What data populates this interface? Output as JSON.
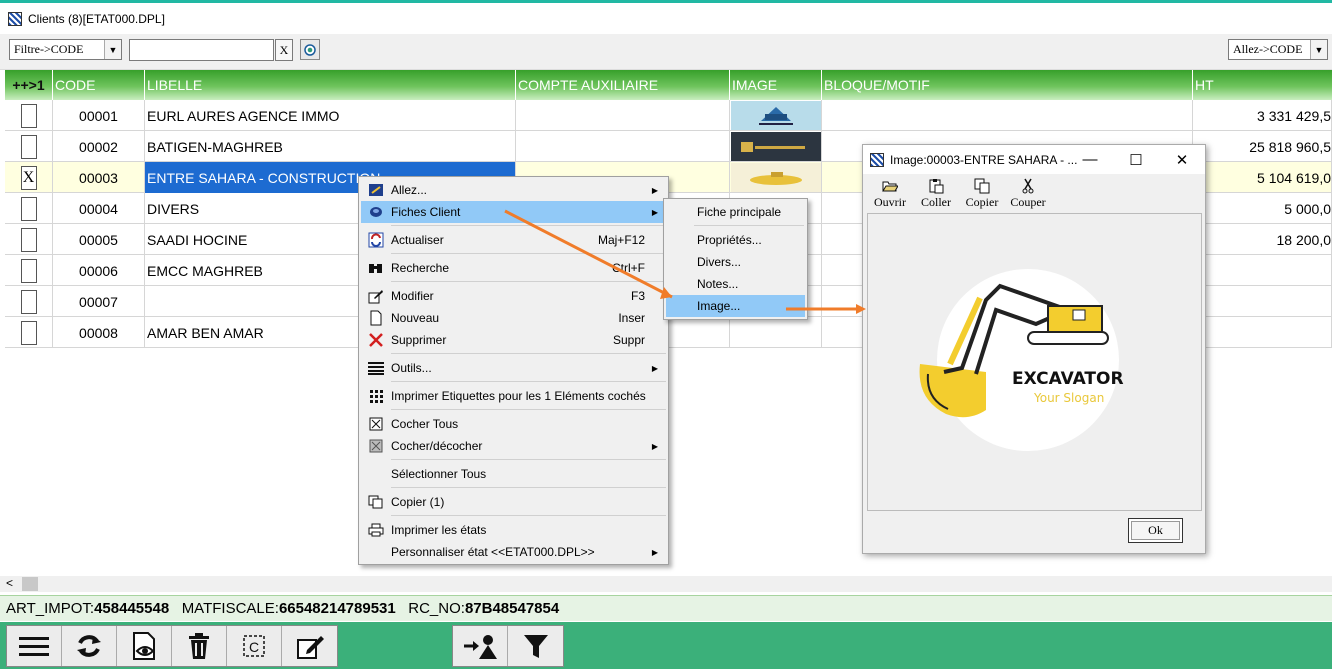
{
  "window": {
    "title": "Clients (8)[ETAT000.DPL]"
  },
  "toolbar": {
    "filter_select": "Filtre->CODE",
    "search_value": "",
    "clear_label": "X",
    "goto_select": "Allez->CODE"
  },
  "grid": {
    "columns": [
      "++>1",
      "CODE",
      "LIBELLE",
      "COMPTE AUXILIAIRE",
      "IMAGE",
      "BLOQUE/MOTIF",
      "HT"
    ],
    "rows": [
      {
        "checked": "",
        "code": "00001",
        "libelle": "EURL AURES AGENCE IMMO",
        "compte": "",
        "bloque": "",
        "ht": "3 331 429,5"
      },
      {
        "checked": "",
        "code": "00002",
        "libelle": "BATIGEN-MAGHREB",
        "compte": "",
        "bloque": "",
        "ht": "25 818 960,5"
      },
      {
        "checked": "X",
        "code": "00003",
        "libelle": "ENTRE SAHARA - CONSTRUCTION",
        "compte": "",
        "bloque": "",
        "ht": "5 104 619,0"
      },
      {
        "checked": "",
        "code": "00004",
        "libelle": "DIVERS",
        "compte": "",
        "bloque": "",
        "ht": "5 000,0"
      },
      {
        "checked": "",
        "code": "00005",
        "libelle": "SAADI HOCINE",
        "compte": "",
        "bloque": "",
        "ht": "18 200,0"
      },
      {
        "checked": "",
        "code": "00006",
        "libelle": "EMCC MAGHREB",
        "compte": "",
        "bloque": "",
        "ht": ""
      },
      {
        "checked": "",
        "code": "00007",
        "libelle": "",
        "compte": "",
        "bloque": "",
        "ht": ""
      },
      {
        "checked": "",
        "code": "00008",
        "libelle": "AMAR BEN AMAR",
        "compte": "",
        "bloque": "",
        "ht": ""
      }
    ]
  },
  "context_menu": {
    "items": [
      {
        "label": "Allez...",
        "shortcut": "",
        "icon": "goto-icon"
      },
      {
        "label": "Fiches Client",
        "shortcut": "",
        "icon": "client-card-icon"
      },
      {
        "label": "Actualiser",
        "shortcut": "Maj+F12",
        "icon": "refresh-icon"
      },
      {
        "label": "Recherche",
        "shortcut": "Ctrl+F",
        "icon": "binoculars-icon"
      },
      {
        "label": "Modifier",
        "shortcut": "F3",
        "icon": "edit-icon"
      },
      {
        "label": "Nouveau",
        "shortcut": "Inser",
        "icon": "new-document-icon"
      },
      {
        "label": "Supprimer",
        "shortcut": "Suppr",
        "icon": "delete-x-icon"
      },
      {
        "label": "Outils...",
        "shortcut": "",
        "icon": "tools-icon"
      },
      {
        "label": "Imprimer Etiquettes pour les 1 Eléments cochés",
        "shortcut": "",
        "icon": "labels-grid-icon"
      },
      {
        "label": "Cocher Tous",
        "shortcut": "",
        "icon": "check-all-icon"
      },
      {
        "label": "Cocher/décocher",
        "shortcut": "",
        "icon": "toggle-check-icon"
      },
      {
        "label": "Sélectionner Tous",
        "shortcut": "",
        "icon": ""
      },
      {
        "label": "Copier (1)",
        "shortcut": "",
        "icon": "copy-icon"
      },
      {
        "label": "Imprimer les états",
        "shortcut": "",
        "icon": "printer-icon"
      },
      {
        "label": "Personnaliser état <<ETAT000.DPL>>",
        "shortcut": "",
        "icon": ""
      }
    ]
  },
  "submenu": {
    "items": [
      "Fiche principale",
      "Propriétés...",
      "Divers...",
      "Notes...",
      "Image..."
    ]
  },
  "image_window": {
    "title": "Image:00003-ENTRE SAHARA - ...",
    "tools": [
      "Ouvrir",
      "Coller",
      "Copier",
      "Couper"
    ],
    "logo_title": "EXCAVATOR",
    "logo_slogan": "Your Slogan",
    "ok_label": "Ok"
  },
  "infobar": {
    "art_label": "ART_IMPOT:",
    "art_value": "458445548",
    "mat_label": "MATFISCALE:",
    "mat_value": "66548214789531",
    "rc_label": "RC_NO:",
    "rc_value": "87B48547854"
  },
  "colors": {
    "accent_green": "#3bb07a",
    "header_green": "#37a02b",
    "selection_blue": "#1d6bd1",
    "menu_highlight": "#91c9f7",
    "arrow_orange": "#f07c2a"
  }
}
